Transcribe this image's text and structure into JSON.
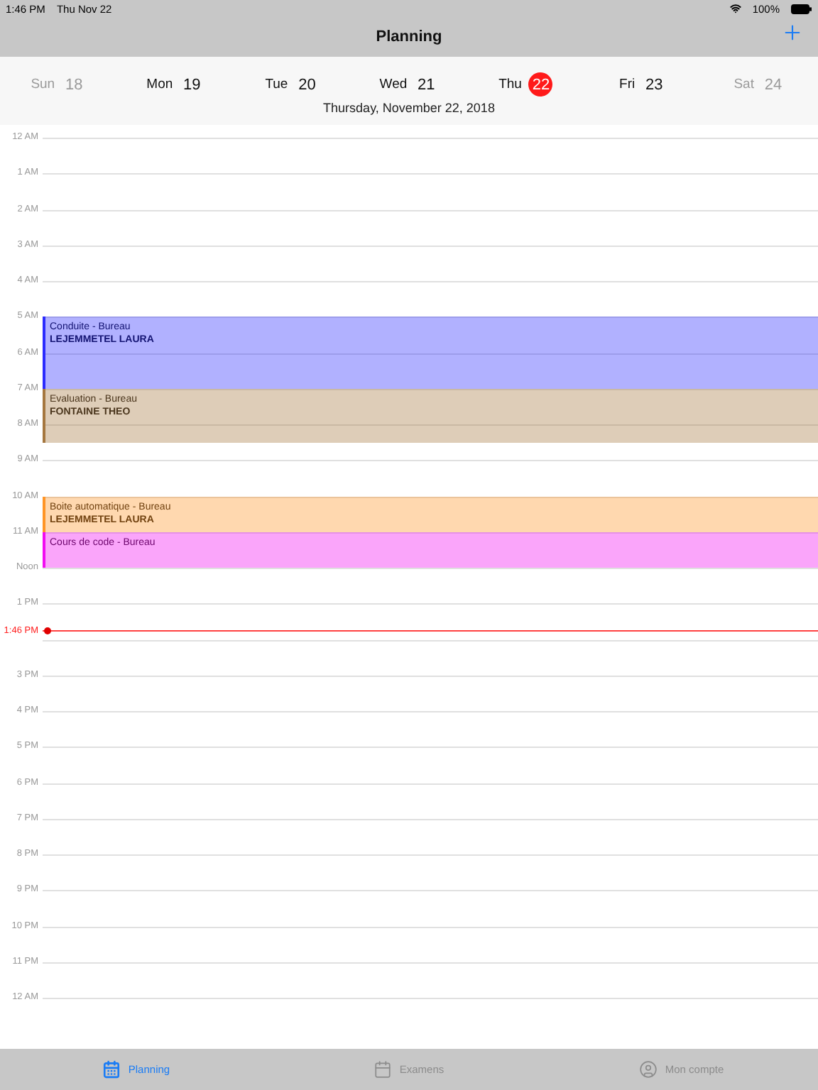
{
  "status_bar": {
    "time": "1:46 PM",
    "date": "Thu Nov 22",
    "battery": "100%"
  },
  "nav_bar": {
    "title": "Planning"
  },
  "week": [
    {
      "day": "Sun",
      "number": "18",
      "muted": true,
      "selected": false
    },
    {
      "day": "Mon",
      "number": "19",
      "muted": false,
      "selected": false
    },
    {
      "day": "Tue",
      "number": "20",
      "muted": false,
      "selected": false
    },
    {
      "day": "Wed",
      "number": "21",
      "muted": false,
      "selected": false
    },
    {
      "day": "Thu",
      "number": "22",
      "muted": false,
      "selected": true
    },
    {
      "day": "Fri",
      "number": "23",
      "muted": false,
      "selected": false
    },
    {
      "day": "Sat",
      "number": "24",
      "muted": true,
      "selected": false
    }
  ],
  "selected_date": "Thursday, November 22, 2018",
  "hours": [
    "12 AM",
    "1 AM",
    "2 AM",
    "3 AM",
    "4 AM",
    "5 AM",
    "6 AM",
    "7 AM",
    "8 AM",
    "9 AM",
    "10 AM",
    "11 AM",
    "Noon",
    "1 PM",
    "3 PM",
    "4 PM",
    "5 PM",
    "6 PM",
    "7 PM",
    "8 PM",
    "9 PM",
    "10 PM",
    "11 PM",
    "12 AM"
  ],
  "events": [
    {
      "title": "Conduite - Bureau",
      "person": "LEJEMMETEL LAURA",
      "color": "#2b2bff"
    },
    {
      "title": "Evaluation - Bureau",
      "person": "FONTAINE THEO",
      "color": "#a5773f"
    },
    {
      "title": "Boite automatique - Bureau",
      "person": "LEJEMMETEL LAURA",
      "color": "#ff9526"
    },
    {
      "title": "Cours de code - Bureau",
      "color": "#f20cf2"
    }
  ],
  "current_time": "1:46 PM",
  "tab_bar": [
    {
      "label": "Planning",
      "selected": true
    },
    {
      "label": "Examens",
      "selected": false
    },
    {
      "label": "Mon compte",
      "selected": false
    }
  ]
}
